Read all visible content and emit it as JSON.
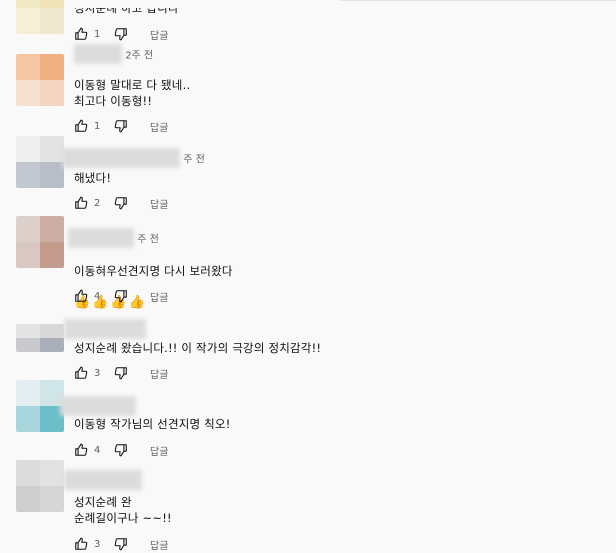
{
  "comments": [
    {
      "author_time": "",
      "text": "성지순례 하고 갑니다",
      "likes": "1",
      "reply_label": "답글",
      "avatar_colors": [
        "#f2e9c6",
        "#efe2b7",
        "#f6efd8",
        "#efe8cf"
      ]
    },
    {
      "author_time": "2주 전",
      "text": "이동형 말대로 다 됐네..\n최고다 이동형!!",
      "likes": "1",
      "reply_label": "답글",
      "avatar_colors": [
        "#f4c6a3",
        "#eeaf83",
        "#f5e0d1",
        "#f3d4be"
      ]
    },
    {
      "author_time": "주 전",
      "text": "해냈다!",
      "likes": "2",
      "reply_label": "답글",
      "avatar_colors": [
        "#eeeeee",
        "#e3e3e3",
        "#c3c7d0",
        "#b8bdc8"
      ]
    },
    {
      "author_time": "주 전",
      "text": "이동혀우선견지명 다시 보러왔다\n👍👍👍👍",
      "likes": "4",
      "reply_label": "답글",
      "avatar_colors": [
        "#ddd0cb",
        "#ccaea4",
        "#d9c8c1",
        "#c49c8e"
      ]
    },
    {
      "author_time": "",
      "text": "성지순례 왔습니다.!! 이 작가의 극강의 정치감각!!",
      "likes": "3",
      "reply_label": "답글",
      "avatar_colors": [
        "#e4e4e4",
        "#d8d8d8",
        "#c8cacd",
        "#a9afb8"
      ]
    },
    {
      "author_time": "",
      "text": "이동형 작가님의 선견지명 칙오!",
      "likes": "4",
      "reply_label": "답글",
      "avatar_colors": [
        "#e3eef0",
        "#cfe5e8",
        "#a8d6dc",
        "#6cbfc9"
      ]
    },
    {
      "author_time": "",
      "text": "성지순례 완\n순례길이구나 ~~!!",
      "likes": "3",
      "reply_label": "답글",
      "avatar_colors": [
        "#dcdcdc",
        "#e2e2e2",
        "#cfcfcf",
        "#d6d6d6"
      ]
    }
  ]
}
